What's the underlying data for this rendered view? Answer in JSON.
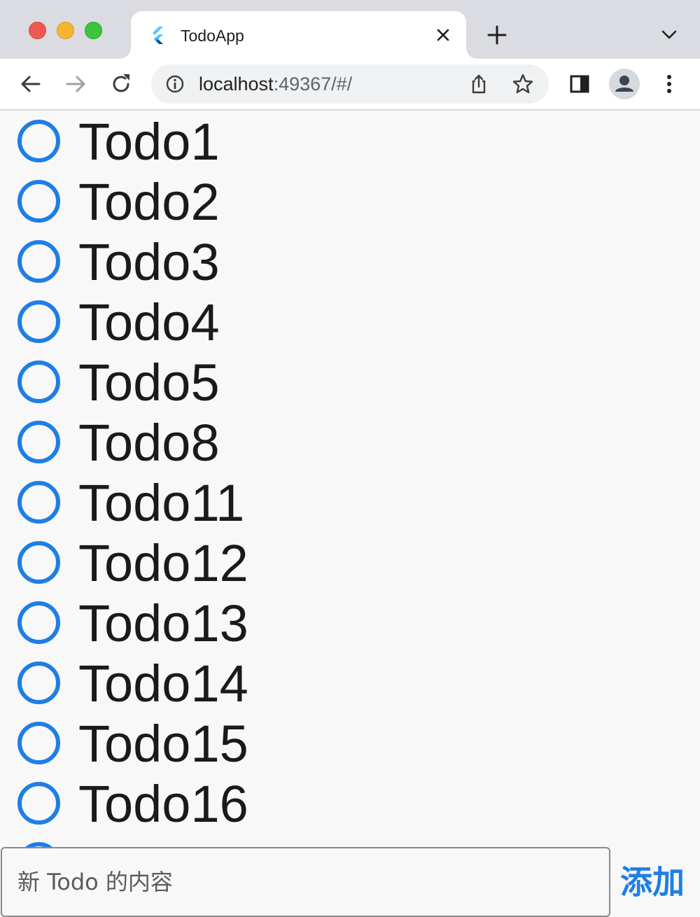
{
  "browser": {
    "tab": {
      "title": "TodoApp",
      "favicon": "flutter-logo-icon"
    },
    "url": {
      "host": "localhost",
      "rest": ":49367/#/"
    },
    "colors": {
      "close": "#ee5a52",
      "minimize": "#f5b530",
      "maximize": "#3cc43a"
    }
  },
  "app": {
    "accent_color": "#1e7ee6",
    "todos": [
      {
        "text": "Todo1",
        "done": false
      },
      {
        "text": "Todo2",
        "done": false
      },
      {
        "text": "Todo3",
        "done": false
      },
      {
        "text": "Todo4",
        "done": false
      },
      {
        "text": "Todo5",
        "done": false
      },
      {
        "text": "Todo8",
        "done": false
      },
      {
        "text": "Todo11",
        "done": false
      },
      {
        "text": "Todo12",
        "done": false
      },
      {
        "text": "Todo13",
        "done": false
      },
      {
        "text": "Todo14",
        "done": false
      },
      {
        "text": "Todo15",
        "done": false
      },
      {
        "text": "Todo16",
        "done": false
      },
      {
        "text": "",
        "done": false
      }
    ],
    "input": {
      "placeholder": "新 Todo 的内容",
      "value": ""
    },
    "add_button_label": "添加"
  }
}
